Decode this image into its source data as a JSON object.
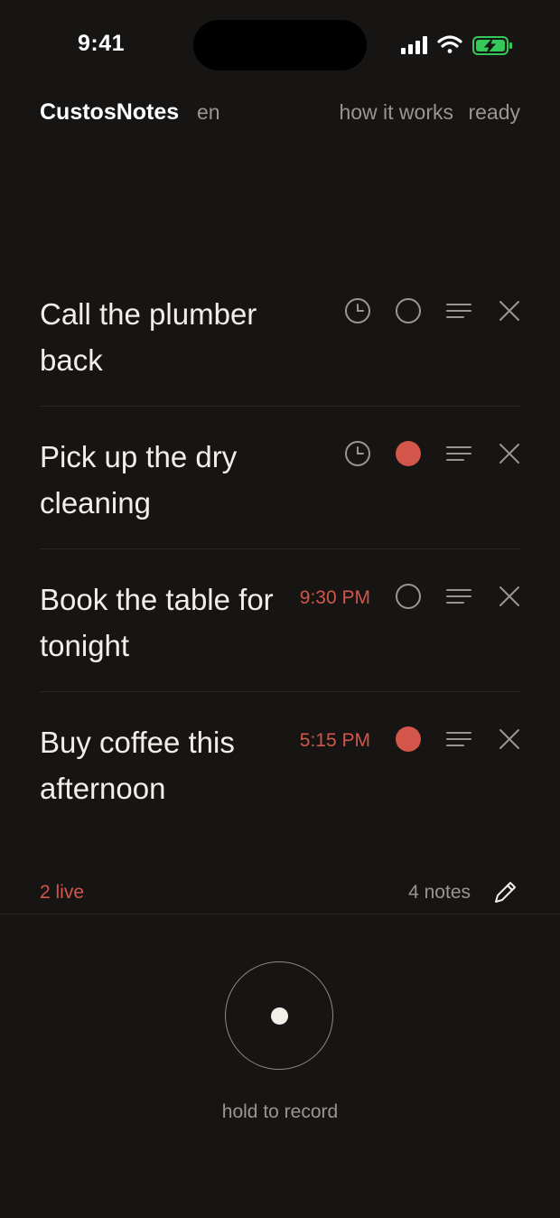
{
  "status_bar": {
    "time": "9:41",
    "icons": [
      "signal-icon",
      "wifi-icon",
      "battery-charging-icon"
    ],
    "battery_color": "#34c759"
  },
  "header": {
    "app_name": "CustosNotes",
    "language": "en",
    "help_link": "how it works",
    "status": "ready"
  },
  "notes": [
    {
      "text": "Call the plumber back",
      "time": "",
      "live": false
    },
    {
      "text": "Pick up the dry cleaning",
      "time": "",
      "live": true
    },
    {
      "text": "Book the table for tonight",
      "time": "9:30 PM",
      "live": false
    },
    {
      "text": "Buy coffee this afternoon",
      "time": "5:15 PM",
      "live": true
    }
  ],
  "footer": {
    "live_count": "2 live",
    "notes_count": "4 notes",
    "edit_icon": "pencil-icon"
  },
  "record": {
    "hint": "hold to record"
  },
  "colors": {
    "background": "#161513",
    "text": "#f2efe9",
    "muted": "#9a968f",
    "accent": "#d2564a",
    "divider": "#2a2825"
  }
}
